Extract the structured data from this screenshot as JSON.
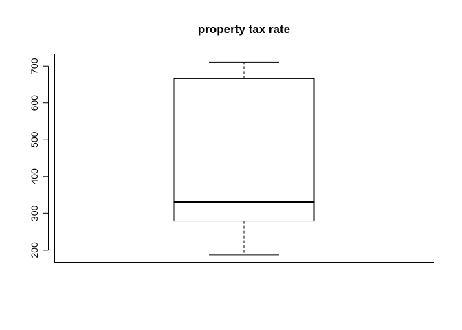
{
  "chart_data": {
    "type": "boxplot",
    "title": "property tax rate",
    "xlabel": "",
    "ylabel": "",
    "ylim": [
      168,
      734
    ],
    "y_ticks": [
      200,
      300,
      400,
      500,
      600,
      700
    ],
    "y_tick_labels": [
      "200",
      "300",
      "400",
      "500",
      "600",
      "700"
    ],
    "grid": false,
    "boxes": [
      {
        "whisker_low": 187,
        "q1": 279,
        "median": 330,
        "q3": 666,
        "whisker_high": 711
      }
    ]
  }
}
